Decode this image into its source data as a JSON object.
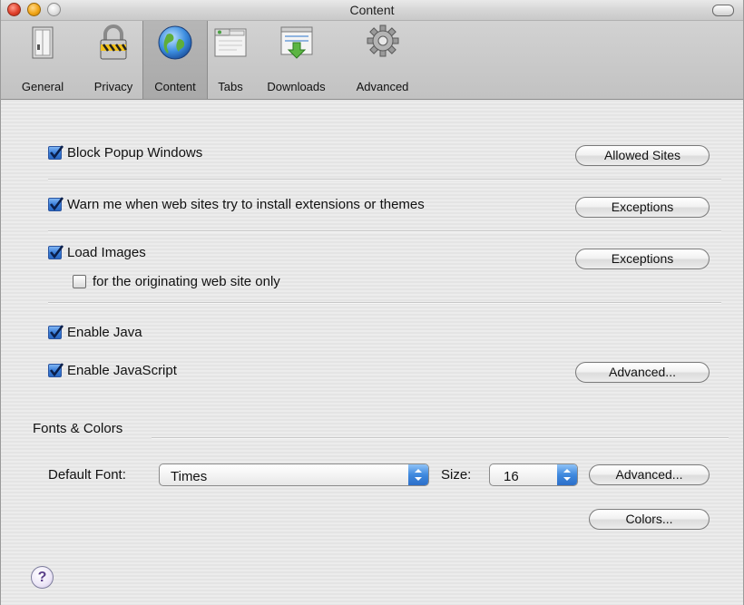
{
  "window": {
    "title": "Content"
  },
  "toolbar": {
    "items": [
      {
        "label": "General",
        "icon": "general-switch-icon"
      },
      {
        "label": "Privacy",
        "icon": "privacy-lock-icon"
      },
      {
        "label": "Content",
        "icon": "content-globe-icon"
      },
      {
        "label": "Tabs",
        "icon": "tabs-window-icon"
      },
      {
        "label": "Downloads",
        "icon": "downloads-icon"
      },
      {
        "label": "Advanced",
        "icon": "advanced-gear-icon"
      }
    ],
    "selected": "Content"
  },
  "content": {
    "block_popups": {
      "label": "Block Popup Windows",
      "checked": true,
      "button": "Allowed Sites"
    },
    "warn_install": {
      "label": "Warn me when web sites try to install extensions or themes",
      "checked": true,
      "button": "Exceptions"
    },
    "load_images": {
      "label": "Load Images",
      "checked": true,
      "button": "Exceptions"
    },
    "originating_only": {
      "label": "for the originating web site only",
      "checked": false
    },
    "enable_java": {
      "label": "Enable Java",
      "checked": true
    },
    "enable_javascript": {
      "label": "Enable JavaScript",
      "checked": true,
      "button": "Advanced..."
    }
  },
  "fonts": {
    "section_label": "Fonts & Colors",
    "default_font_label": "Default Font:",
    "default_font_value": "Times",
    "size_label": "Size:",
    "size_value": "16",
    "advanced_button": "Advanced...",
    "colors_button": "Colors..."
  },
  "help": {
    "glyph": "?"
  },
  "colors": {
    "checkbox_blue": "#3a7fdb",
    "select_arrow_blue": "#3f89de"
  }
}
